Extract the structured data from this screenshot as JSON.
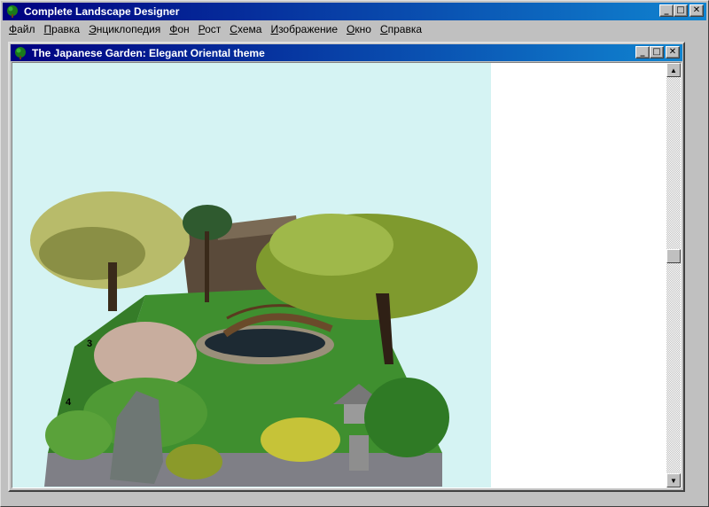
{
  "app": {
    "title": "Complete Landscape Designer",
    "icon": "tree-icon"
  },
  "menu": [
    {
      "label": "Файл",
      "u": "Ф",
      "rest": "айл"
    },
    {
      "label": "Правка",
      "u": "П",
      "rest": "равка"
    },
    {
      "label": "Энциклопедия",
      "u": "Э",
      "rest": "нциклопедия"
    },
    {
      "label": "Фон",
      "u": "Ф",
      "rest": "он"
    },
    {
      "label": "Рост",
      "u": "Р",
      "rest": "ост"
    },
    {
      "label": "Схема",
      "u": "С",
      "rest": "хема"
    },
    {
      "label": "Изображение",
      "u": "И",
      "rest": "зображение"
    },
    {
      "label": "Окно",
      "u": "О",
      "rest": "кно"
    },
    {
      "label": "Справка",
      "u": "С",
      "rest": "правка"
    }
  ],
  "document": {
    "title": "The Japanese Garden: Elegant Oriental theme",
    "icon": "tree-icon"
  },
  "controls": {
    "minimize": "_",
    "maximize": "□",
    "close": "✕"
  },
  "scroll": {
    "up": "▲",
    "down": "▼",
    "position": 0.45
  },
  "colors": {
    "title_active_start": "#000080",
    "title_active_end": "#1084d0",
    "canvas_sky": "#d5f3f3",
    "lawn": "#3f8f2f"
  },
  "garden_labels": [
    "4",
    "3"
  ]
}
